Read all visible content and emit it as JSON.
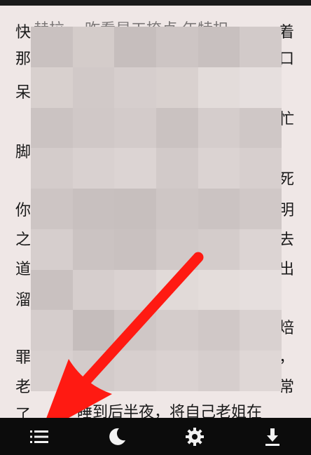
{
  "reader": {
    "left_column": [
      "快",
      "那",
      "呆",
      "脚",
      "你",
      "之",
      "道",
      "溜",
      "罪",
      "老",
      "了"
    ],
    "right_column": [
      "着",
      "口",
      "忙",
      "死",
      "明",
      "去",
      "出",
      "焙",
      "，",
      "常"
    ],
    "top_peek": "赫拉 …昨看显工捺贞 年特扣",
    "bottom_peek": "睡到后半夜，将自己老姐在"
  },
  "toolbar": {
    "items": [
      {
        "name": "menu",
        "icon": "list-icon"
      },
      {
        "name": "night-mode",
        "icon": "moon-icon"
      },
      {
        "name": "settings",
        "icon": "gear-icon"
      },
      {
        "name": "download",
        "icon": "download-icon"
      }
    ]
  },
  "colors": {
    "page_bg": "#efe7e6",
    "toolbar_bg": "#0c0c0c",
    "arrow": "#ff1a12",
    "icon": "#f2f2f2"
  }
}
